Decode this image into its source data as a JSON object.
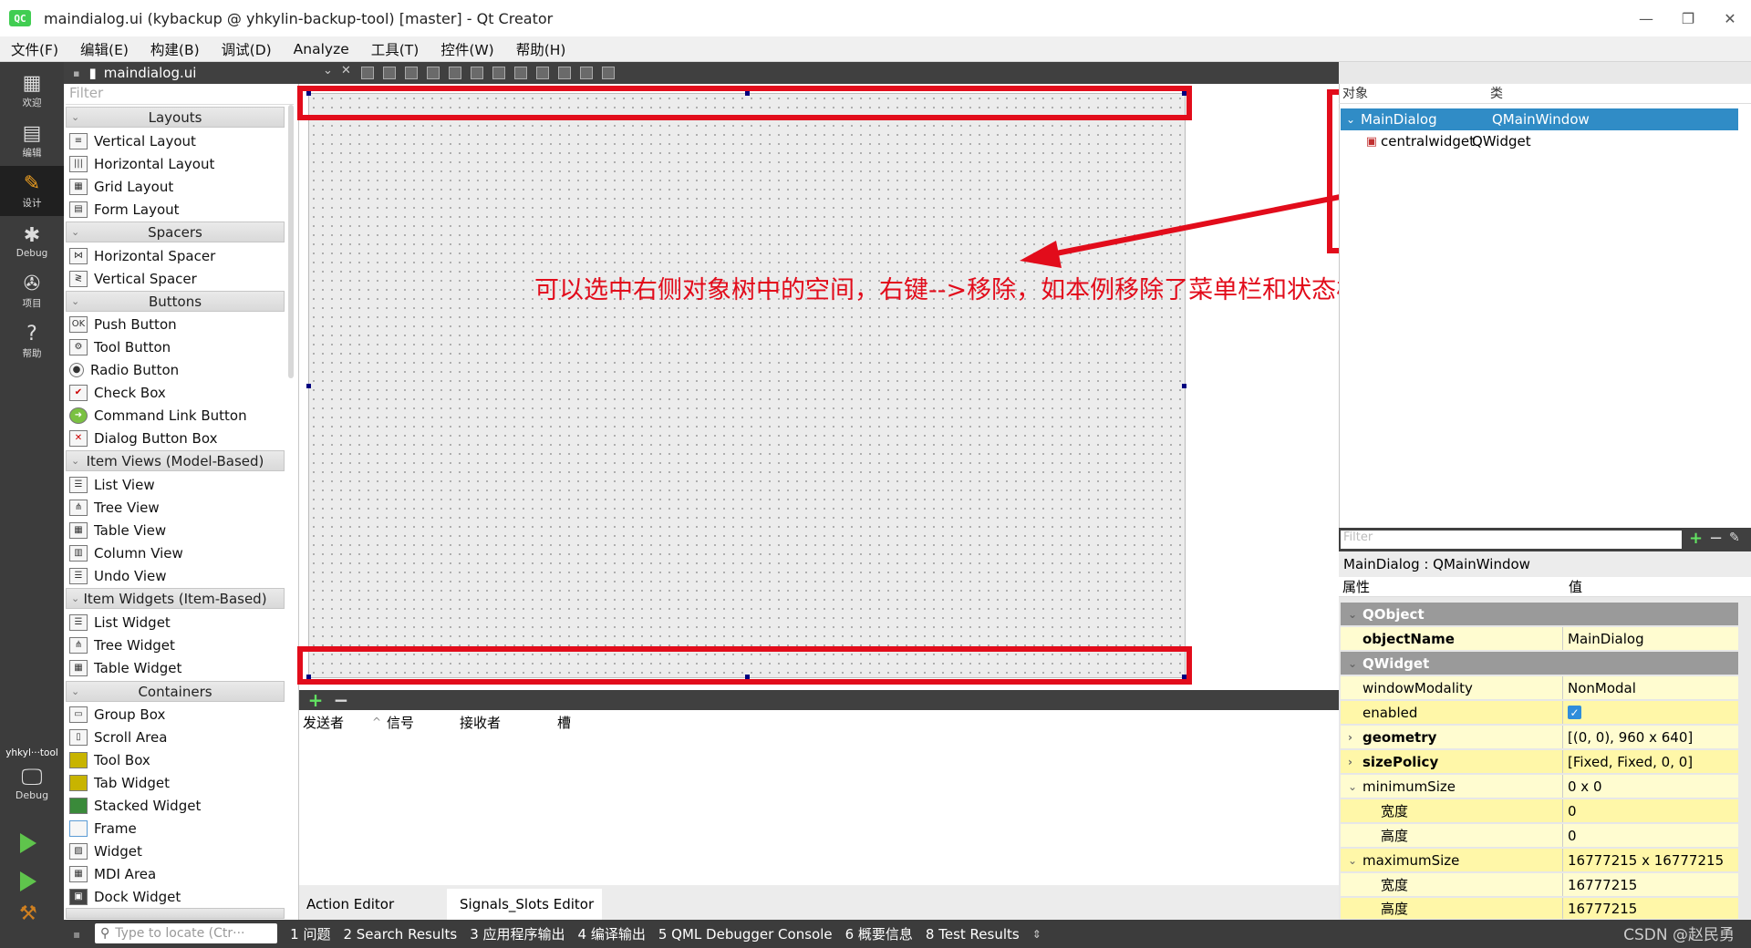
{
  "window": {
    "title": "maindialog.ui (kybackup @ yhkylin-backup-tool) [master] - Qt Creator",
    "app_icon": "QC"
  },
  "window_controls": {
    "minimize": "—",
    "restore": "❐",
    "close": "✕"
  },
  "menu": [
    "文件(F)",
    "编辑(E)",
    "构建(B)",
    "调试(D)",
    "Analyze",
    "工具(T)",
    "控件(W)",
    "帮助(H)"
  ],
  "modes": [
    {
      "label": "欢迎",
      "icon": "▦"
    },
    {
      "label": "编辑",
      "icon": "▤"
    },
    {
      "label": "设计",
      "icon": "✎"
    },
    {
      "label": "Debug",
      "icon": "✱"
    },
    {
      "label": "项目",
      "icon": "✇"
    },
    {
      "label": "帮助",
      "icon": "?"
    }
  ],
  "kit": {
    "label": "yhkyl···tool",
    "sub": "Debug"
  },
  "document_tab": "maindialog.ui",
  "widget_box": {
    "filter_placeholder": "Filter",
    "categories": [
      {
        "name": "Layouts",
        "items": [
          "Vertical Layout",
          "Horizontal Layout",
          "Grid Layout",
          "Form Layout"
        ]
      },
      {
        "name": "Spacers",
        "items": [
          "Horizontal Spacer",
          "Vertical Spacer"
        ]
      },
      {
        "name": "Buttons",
        "items": [
          "Push Button",
          "Tool Button",
          "Radio Button",
          "Check Box",
          "Command Link Button",
          "Dialog Button Box"
        ]
      },
      {
        "name": "Item Views (Model-Based)",
        "items": [
          "List View",
          "Tree View",
          "Table View",
          "Column View",
          "Undo View"
        ]
      },
      {
        "name": "Item Widgets (Item-Based)",
        "items": [
          "List Widget",
          "Tree Widget",
          "Table Widget"
        ]
      },
      {
        "name": "Containers",
        "items": [
          "Group Box",
          "Scroll Area",
          "Tool Box",
          "Tab Widget",
          "Stacked Widget",
          "Frame",
          "Widget",
          "MDI Area",
          "Dock Widget"
        ]
      }
    ]
  },
  "annotation": "可以选中右侧对象树中的空间，右键-->移除，如本例移除了菜单栏和状态栏",
  "object_inspector": {
    "col_object": "对象",
    "col_class": "类",
    "rows": [
      {
        "object": "MainDialog",
        "class": "QMainWindow",
        "selected": true
      },
      {
        "object": "centralwidget",
        "class": "QWidget",
        "selected": false
      }
    ]
  },
  "property_editor": {
    "filter_placeholder": "Filter",
    "class_label": "MainDialog : QMainWindow",
    "col_property": "属性",
    "col_value": "值",
    "rows": [
      {
        "name": "QObject",
        "value": "",
        "kind": "group"
      },
      {
        "name": "objectName",
        "value": "MainDialog",
        "kind": "bold"
      },
      {
        "name": "QWidget",
        "value": "",
        "kind": "group"
      },
      {
        "name": "windowModality",
        "value": "NonModal",
        "kind": "plain"
      },
      {
        "name": "enabled",
        "value": "",
        "kind": "check"
      },
      {
        "name": "geometry",
        "value": "[(0, 0), 960 x 640]",
        "kind": "bold-exp"
      },
      {
        "name": "sizePolicy",
        "value": "[Fixed, Fixed, 0, 0]",
        "kind": "bold-exp"
      },
      {
        "name": "minimumSize",
        "value": "0 x 0",
        "kind": "open"
      },
      {
        "name": "宽度",
        "value": "0",
        "kind": "sub"
      },
      {
        "name": "高度",
        "value": "0",
        "kind": "sub"
      },
      {
        "name": "maximumSize",
        "value": "16777215 x 16777215",
        "kind": "open"
      },
      {
        "name": "宽度",
        "value": "16777215",
        "kind": "sub"
      },
      {
        "name": "高度",
        "value": "16777215",
        "kind": "sub"
      }
    ]
  },
  "signals": {
    "add": "+",
    "remove": "−",
    "cols": [
      "发送者",
      "信号",
      "接收者",
      "槽"
    ]
  },
  "editor_tabs": [
    "Action Editor",
    "Signals_Slots Editor"
  ],
  "statusbar": {
    "locate_placeholder": "Type to locate (Ctr···",
    "outputs": [
      "1 问题",
      "2 Search Results",
      "3 应用程序输出",
      "4 编译输出",
      "5 QML Debugger Console",
      "6 概要信息",
      "8 Test Results"
    ],
    "watermark": "CSDN @赵民勇"
  },
  "colors": {
    "annotation_red": "#e20c1b",
    "selection_blue": "#308cc6",
    "dark_bar": "#404040"
  }
}
